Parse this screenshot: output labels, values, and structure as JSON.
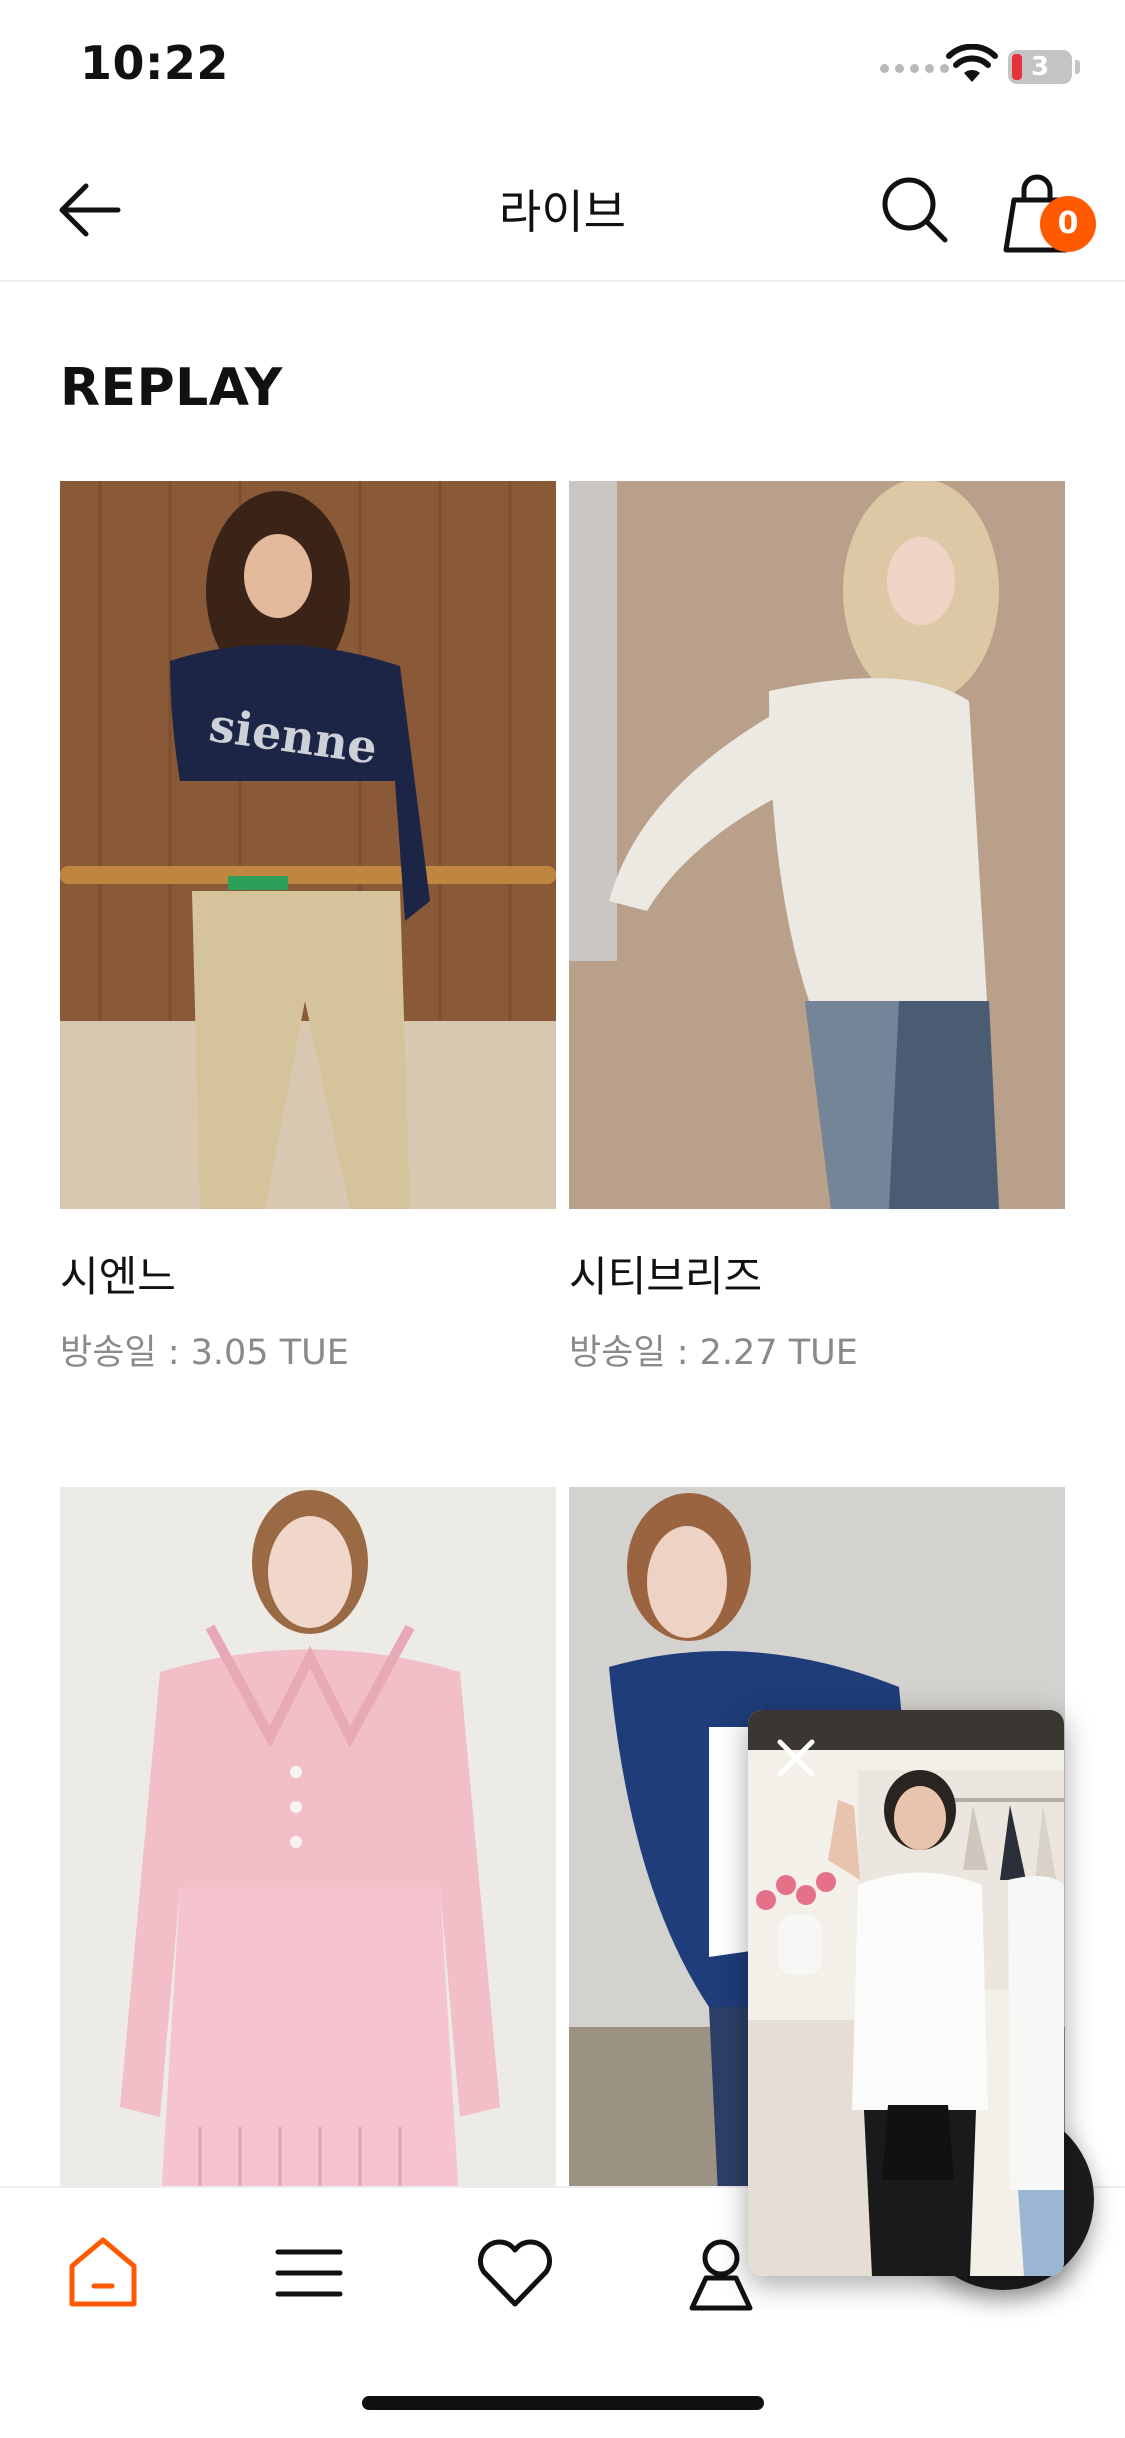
{
  "status_bar": {
    "time": "10:22",
    "battery": "3",
    "icons": [
      "signal-icon",
      "wifi-icon",
      "battery-icon"
    ]
  },
  "header": {
    "title": "라이브",
    "cart_count": "0",
    "icons": [
      "back-arrow-icon",
      "search-icon",
      "shopping-bag-icon"
    ]
  },
  "section": {
    "title": "REPLAY"
  },
  "items": [
    {
      "brand": "시엔느",
      "date": "방송일 : 3.05 TUE"
    },
    {
      "brand": "시티브리즈",
      "date": "방송일 : 2.27 TUE"
    },
    {
      "brand": "",
      "date": ""
    },
    {
      "brand": "",
      "date": ""
    }
  ],
  "live_player": {
    "icons": [
      "close-icon"
    ]
  },
  "tab_bar": {
    "icons": [
      "home-icon",
      "menu-icon",
      "heart-icon",
      "user-icon"
    ]
  },
  "colors": {
    "accent": "#ff5a00",
    "text": "#111111",
    "subtext": "#8a8a8a"
  }
}
